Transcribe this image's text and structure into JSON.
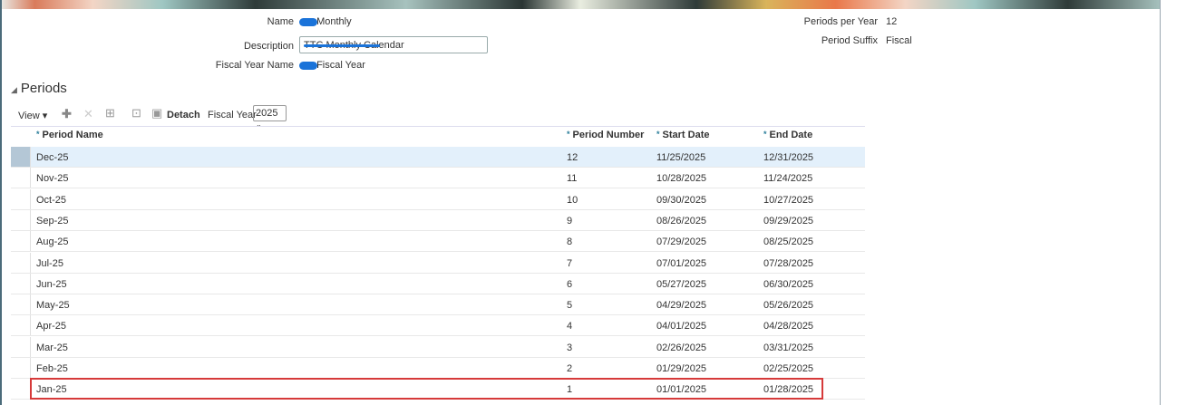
{
  "header": {
    "name_label": "Name",
    "name_value": "Monthly",
    "description_label": "Description",
    "description_value": "TTC Monthly Calendar",
    "fiscal_year_name_label": "Fiscal Year Name",
    "fiscal_year_name_value": "Fiscal Year",
    "periods_per_year_label": "Periods per Year",
    "periods_per_year_value": "12",
    "period_suffix_label": "Period Suffix",
    "period_suffix_value": "Fiscal"
  },
  "section": {
    "title": "Periods"
  },
  "toolbar": {
    "view_label": "View",
    "detach_label": "Detach",
    "fiscal_year_label": "Fiscal Year",
    "fiscal_year_value": "2025",
    "icons": [
      "add-icon",
      "delete-icon",
      "export-icon",
      "freeze-icon",
      "detach-icon"
    ]
  },
  "table": {
    "columns": [
      "Period Name",
      "Period Number",
      "Start Date",
      "End Date"
    ],
    "rows": [
      [
        "Dec-25",
        "12",
        "11/25/2025",
        "12/31/2025"
      ],
      [
        "Nov-25",
        "11",
        "10/28/2025",
        "11/24/2025"
      ],
      [
        "Oct-25",
        "10",
        "09/30/2025",
        "10/27/2025"
      ],
      [
        "Sep-25",
        "9",
        "08/26/2025",
        "09/29/2025"
      ],
      [
        "Aug-25",
        "8",
        "07/29/2025",
        "08/25/2025"
      ],
      [
        "Jul-25",
        "7",
        "07/01/2025",
        "07/28/2025"
      ],
      [
        "Jun-25",
        "6",
        "05/27/2025",
        "06/30/2025"
      ],
      [
        "May-25",
        "5",
        "04/29/2025",
        "05/26/2025"
      ],
      [
        "Apr-25",
        "4",
        "04/01/2025",
        "04/28/2025"
      ],
      [
        "Mar-25",
        "3",
        "02/26/2025",
        "03/31/2025"
      ],
      [
        "Feb-25",
        "2",
        "01/29/2025",
        "02/25/2025"
      ],
      [
        "Jan-25",
        "1",
        "01/01/2025",
        "01/28/2025"
      ]
    ],
    "selected_row": 0,
    "highlighted_row": 11
  },
  "colors": {
    "accent": "#2a7d9a",
    "selected_row": "#e3f0fb",
    "highlight_box": "#d63a3a",
    "redaction": "#1a73d9"
  }
}
